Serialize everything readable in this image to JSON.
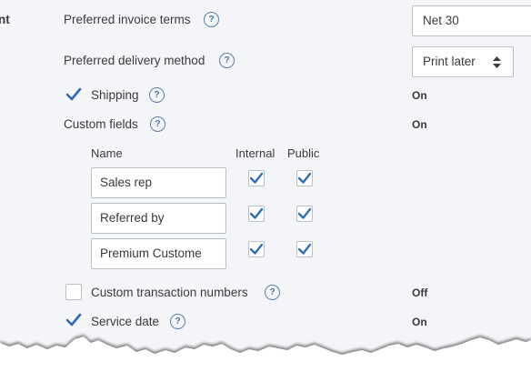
{
  "left_edge_text": "nt",
  "invoice_terms": {
    "label": "Preferred invoice terms",
    "help_icon": "question-circle-icon",
    "value": "Net 30"
  },
  "delivery_method": {
    "label": "Preferred delivery method",
    "help_icon": "question-circle-icon",
    "value": "Print later",
    "caret_icon": "up-down-caret-icon"
  },
  "shipping": {
    "label": "Shipping",
    "checked": true,
    "status": "On"
  },
  "custom_fields": {
    "label": "Custom fields",
    "status": "On",
    "columns": {
      "name": "Name",
      "internal": "Internal",
      "public": "Public"
    },
    "rows": [
      {
        "name": "Sales rep",
        "internal": true,
        "public": true
      },
      {
        "name": "Referred by",
        "internal": true,
        "public": true
      },
      {
        "name": "Premium Custome",
        "internal": true,
        "public": true
      }
    ]
  },
  "custom_transaction_numbers": {
    "label": "Custom transaction numbers",
    "checked": false,
    "status": "Off"
  },
  "service_date": {
    "label": "Service date",
    "checked": true,
    "status": "On"
  },
  "colors": {
    "accent": "#2d6bb5",
    "background": "#f4f5f8",
    "text": "#393a3d",
    "help": "#4a74a4"
  }
}
